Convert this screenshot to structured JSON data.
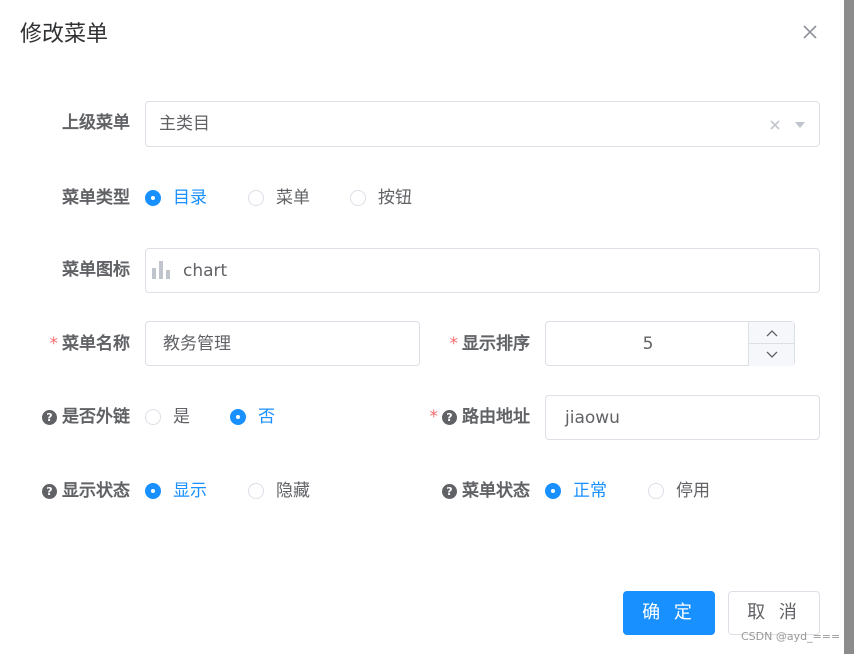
{
  "dialog": {
    "title": "修改菜单",
    "close_icon": "close-icon"
  },
  "form": {
    "parent_menu": {
      "label": "上级菜单",
      "value": "主类目"
    },
    "menu_type": {
      "label": "菜单类型",
      "options": [
        "目录",
        "菜单",
        "按钮"
      ],
      "selected": "目录"
    },
    "menu_icon": {
      "label": "菜单图标",
      "value": "chart",
      "icon": "bar-chart-icon"
    },
    "menu_name": {
      "label": "菜单名称",
      "required_mark": "*",
      "value": "教务管理"
    },
    "sort_order": {
      "label": "显示排序",
      "required_mark": "*",
      "value": "5",
      "up_glyph": "︿",
      "down_glyph": "﹀"
    },
    "external_link": {
      "label": "是否外链",
      "help_glyph": "?",
      "options": [
        "是",
        "否"
      ],
      "selected": "否"
    },
    "route_path": {
      "label": "路由地址",
      "required_mark": "*",
      "help_glyph": "?",
      "value": "jiaowu"
    },
    "visible_status": {
      "label": "显示状态",
      "help_glyph": "?",
      "options": [
        "显示",
        "隐藏"
      ],
      "selected": "显示"
    },
    "menu_status": {
      "label": "菜单状态",
      "help_glyph": "?",
      "options": [
        "正常",
        "停用"
      ],
      "selected": "正常"
    }
  },
  "footer": {
    "confirm_label": "确 定",
    "cancel_label": "取 消"
  },
  "watermark": "CSDN @ayd_===",
  "colors": {
    "primary": "#1890ff",
    "required": "#f56c6c",
    "border": "#dcdfe6"
  }
}
